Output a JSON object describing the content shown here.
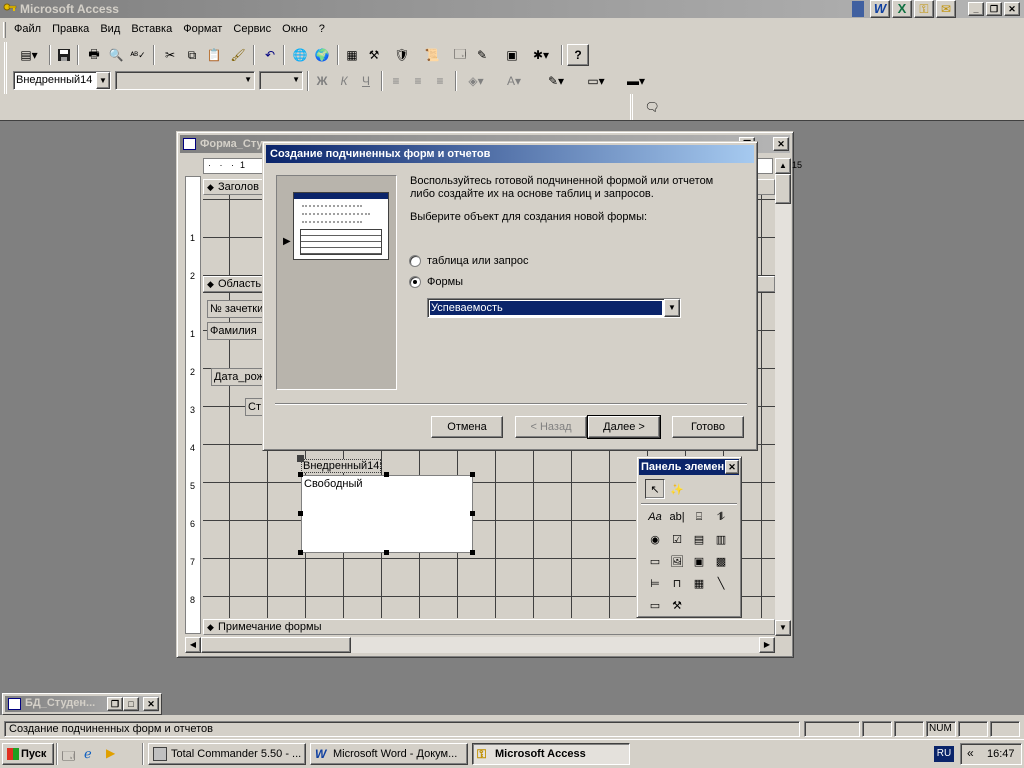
{
  "app": {
    "title": "Microsoft Access",
    "window_buttons": [
      "_",
      "❐",
      "✕"
    ]
  },
  "menu": [
    {
      "label": "Файл"
    },
    {
      "label": "Правка"
    },
    {
      "label": "Вид"
    },
    {
      "label": "Вставка"
    },
    {
      "label": "Формат"
    },
    {
      "label": "Сервис"
    },
    {
      "label": "Окно"
    },
    {
      "label": "?"
    }
  ],
  "format_toolbar": {
    "object_value": "Внедренный14",
    "font_value": "",
    "size_value": "",
    "bold": "Ж",
    "italic": "К",
    "underline": "Ч"
  },
  "form_window": {
    "title": "Форма_Студе...",
    "header_section": "Заголов",
    "detail_section": "Область",
    "footer_section": "Примечание формы",
    "fields": [
      "№ зачетки",
      "Фамилия",
      "Дата_рож",
      "Ст"
    ],
    "subform_label": "Внедренный14:",
    "subform_text": "Свободный",
    "ruler_marks": [
      "1",
      "2",
      "3",
      "4",
      "5",
      "6",
      "7",
      "8"
    ],
    "top_ruler_marks": [
      "1"
    ],
    "top_ruler_right": "15"
  },
  "dialog": {
    "title": "Создание подчиненных форм и отчетов",
    "intro_line1": "Воспользуйтесь готовой подчиненной формой или отчетом",
    "intro_line2": "либо создайте их на основе таблиц и запросов.",
    "prompt": "Выберите объект для создания новой формы:",
    "option_table": "таблица или запрос",
    "option_forms": "Формы",
    "selected_option": "Формы",
    "form_select_value": "Успеваемость",
    "buttons": {
      "cancel": "Отмена",
      "back": "< Назад",
      "next": "Далее >",
      "finish": "Готово"
    }
  },
  "toolbox": {
    "title": "Панель элемен"
  },
  "db_window": {
    "title": "БД_Студен..."
  },
  "status": {
    "text": "Создание подчиненных форм и отчетов",
    "num": "NUM"
  },
  "taskbar": {
    "start": "Пуск",
    "tasks": [
      {
        "label": "Total Commander 5.50 - ..."
      },
      {
        "label": "Microsoft Word - Докум..."
      },
      {
        "label": "Microsoft Access"
      }
    ],
    "lang": "RU",
    "chevron": "«",
    "time": "16:47"
  },
  "colors": {
    "active_title": "#0a246a",
    "inactive_title": "#808080",
    "face": "#d4d0c8",
    "desktop": "#808080"
  }
}
